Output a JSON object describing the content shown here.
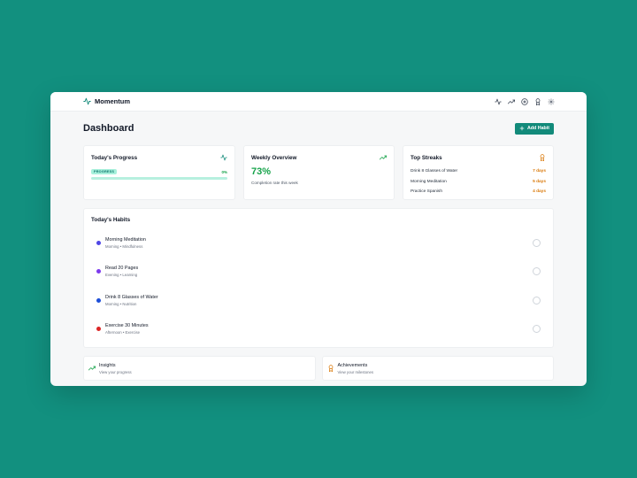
{
  "app": {
    "name": "Momentum",
    "logo_icon": "activity-icon",
    "accent": "#12907f"
  },
  "nav": {
    "icons": [
      "activity-icon",
      "trending-up-icon",
      "target-icon",
      "award-icon",
      "settings-icon"
    ]
  },
  "header": {
    "title": "Dashboard",
    "add_button": "Add Habit"
  },
  "progress_card": {
    "title": "Today's Progress",
    "badge": "PROGRESS",
    "percent_label": "0%",
    "progress_value": 0
  },
  "weekly_card": {
    "title": "Weekly Overview",
    "value": "73%",
    "caption": "Completion rate this week"
  },
  "streaks_card": {
    "title": "Top Streaks",
    "items": [
      {
        "name": "Drink 8 Glasses of Water",
        "days": "7 days"
      },
      {
        "name": "Morning Meditation",
        "days": "5 days"
      },
      {
        "name": "Practice Spanish",
        "days": "4 days"
      }
    ]
  },
  "habits": {
    "title": "Today's Habits",
    "items": [
      {
        "name": "Morning Meditation",
        "meta": "Morning • Mindfulness",
        "color": "#4f46e5",
        "done": false
      },
      {
        "name": "Read 20 Pages",
        "meta": "Evening • Learning",
        "color": "#7c3aed",
        "done": false
      },
      {
        "name": "Drink 8 Glasses of Water",
        "meta": "Morning • Nutrition",
        "color": "#1d4ed8",
        "done": false
      },
      {
        "name": "Exercise 30 Minutes",
        "meta": "Afternoon • Exercise",
        "color": "#dc2626",
        "done": false
      }
    ]
  },
  "bottom": {
    "insights": {
      "title": "Insights",
      "subtitle": "View your progress"
    },
    "achievements": {
      "title": "Achievements",
      "subtitle": "View your milestones"
    }
  },
  "colors": {
    "brand": "#128a7a",
    "success": "#16a34a",
    "streak": "#d97706"
  }
}
